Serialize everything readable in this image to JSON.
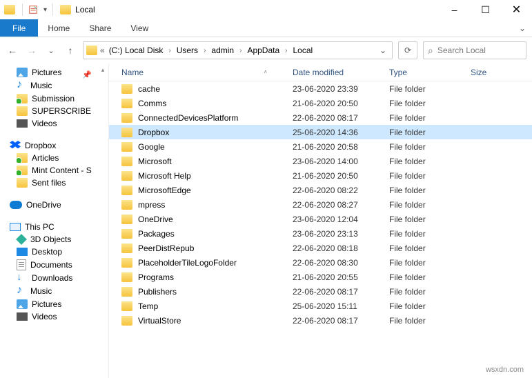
{
  "window": {
    "title": "Local",
    "min": "–",
    "max": "☐",
    "close": "✕"
  },
  "ribbon": {
    "file": "File",
    "home": "Home",
    "share": "Share",
    "view": "View"
  },
  "nav": {
    "back": "←",
    "fwd": "→",
    "dropdown": "⌄",
    "up": "↑",
    "refresh": "⟳",
    "search_placeholder": "Search Local",
    "search_icon": "⌕"
  },
  "breadcrumbs": [
    "(C:) Local Disk",
    "Users",
    "admin",
    "AppData",
    "Local"
  ],
  "columns": {
    "name": "Name",
    "date": "Date modified",
    "type": "Type",
    "size": "Size"
  },
  "sidebar": {
    "g1": [
      {
        "label": "Pictures",
        "icon": "pic",
        "pin": true
      },
      {
        "label": "Music",
        "icon": "music"
      },
      {
        "label": "Submission",
        "icon": "folder-green"
      },
      {
        "label": "SUPERSCRIBE",
        "icon": "folder"
      },
      {
        "label": "Videos",
        "icon": "video"
      }
    ],
    "g2_head": {
      "label": "Dropbox",
      "icon": "dropbox"
    },
    "g2": [
      {
        "label": "Articles",
        "icon": "folder-green"
      },
      {
        "label": "Mint Content - S",
        "icon": "folder-green"
      },
      {
        "label": "Sent files",
        "icon": "folder"
      }
    ],
    "g3_head": {
      "label": "OneDrive",
      "icon": "onedrive"
    },
    "g4_head": {
      "label": "This PC",
      "icon": "pc"
    },
    "g4": [
      {
        "label": "3D Objects",
        "icon": "3d"
      },
      {
        "label": "Desktop",
        "icon": "desktop"
      },
      {
        "label": "Documents",
        "icon": "doc"
      },
      {
        "label": "Downloads",
        "icon": "down"
      },
      {
        "label": "Music",
        "icon": "music"
      },
      {
        "label": "Pictures",
        "icon": "pic"
      },
      {
        "label": "Videos",
        "icon": "video"
      }
    ]
  },
  "rows": [
    {
      "name": "cache",
      "date": "23-06-2020 23:39",
      "type": "File folder"
    },
    {
      "name": "Comms",
      "date": "21-06-2020 20:50",
      "type": "File folder"
    },
    {
      "name": "ConnectedDevicesPlatform",
      "date": "22-06-2020 08:17",
      "type": "File folder"
    },
    {
      "name": "Dropbox",
      "date": "25-06-2020 14:36",
      "type": "File folder",
      "selected": true
    },
    {
      "name": "Google",
      "date": "21-06-2020 20:58",
      "type": "File folder"
    },
    {
      "name": "Microsoft",
      "date": "23-06-2020 14:00",
      "type": "File folder"
    },
    {
      "name": "Microsoft Help",
      "date": "21-06-2020 20:50",
      "type": "File folder"
    },
    {
      "name": "MicrosoftEdge",
      "date": "22-06-2020 08:22",
      "type": "File folder"
    },
    {
      "name": "mpress",
      "date": "22-06-2020 08:27",
      "type": "File folder"
    },
    {
      "name": "OneDrive",
      "date": "23-06-2020 12:04",
      "type": "File folder"
    },
    {
      "name": "Packages",
      "date": "23-06-2020 23:13",
      "type": "File folder"
    },
    {
      "name": "PeerDistRepub",
      "date": "22-06-2020 08:18",
      "type": "File folder"
    },
    {
      "name": "PlaceholderTileLogoFolder",
      "date": "22-06-2020 08:30",
      "type": "File folder"
    },
    {
      "name": "Programs",
      "date": "21-06-2020 20:55",
      "type": "File folder"
    },
    {
      "name": "Publishers",
      "date": "22-06-2020 08:17",
      "type": "File folder"
    },
    {
      "name": "Temp",
      "date": "25-06-2020 15:11",
      "type": "File folder"
    },
    {
      "name": "VirtualStore",
      "date": "22-06-2020 08:17",
      "type": "File folder"
    }
  ],
  "watermark": "wsxdn.com"
}
